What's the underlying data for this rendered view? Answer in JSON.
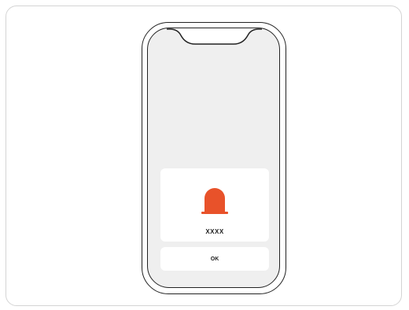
{
  "dialog": {
    "message": "XXXX",
    "icon": "alert-bell-icon",
    "ok_label": "OK"
  },
  "colors": {
    "accent": "#e8522a",
    "screen_bg": "#efefef",
    "dialog_bg": "#ffffff",
    "outline": "#222222"
  }
}
